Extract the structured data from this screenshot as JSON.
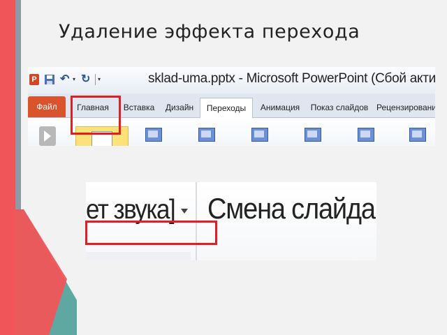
{
  "slide": {
    "title": "Удаление эффекта перехода",
    "colors": {
      "red": "#f0555a",
      "teal": "#5fa8a2",
      "gray": "#8e9aa4",
      "highlight": "#e02020"
    }
  },
  "window": {
    "title": "sklad-uma.pptx  -  Microsoft PowerPoint (Сбой активации продукта"
  },
  "quick_access": {
    "icons": [
      "powerpoint-icon",
      "save-icon",
      "undo-icon",
      "redo-icon",
      "customize-icon"
    ],
    "app_letter": "P",
    "undo_glyph": "↶",
    "redo_glyph": "↻",
    "dropdown_glyph": "▾"
  },
  "tabs": [
    {
      "label": "Файл"
    },
    {
      "label": "Главная"
    },
    {
      "label": "Вставка"
    },
    {
      "label": "Дизайн"
    },
    {
      "label": "Переходы",
      "active": true
    },
    {
      "label": "Анимация"
    },
    {
      "label": "Показ слайдов"
    },
    {
      "label": "Рецензировани"
    }
  ],
  "zoom_fragment": {
    "sound_label": "ет звука]",
    "change_slide_label": "Смена слайда"
  }
}
